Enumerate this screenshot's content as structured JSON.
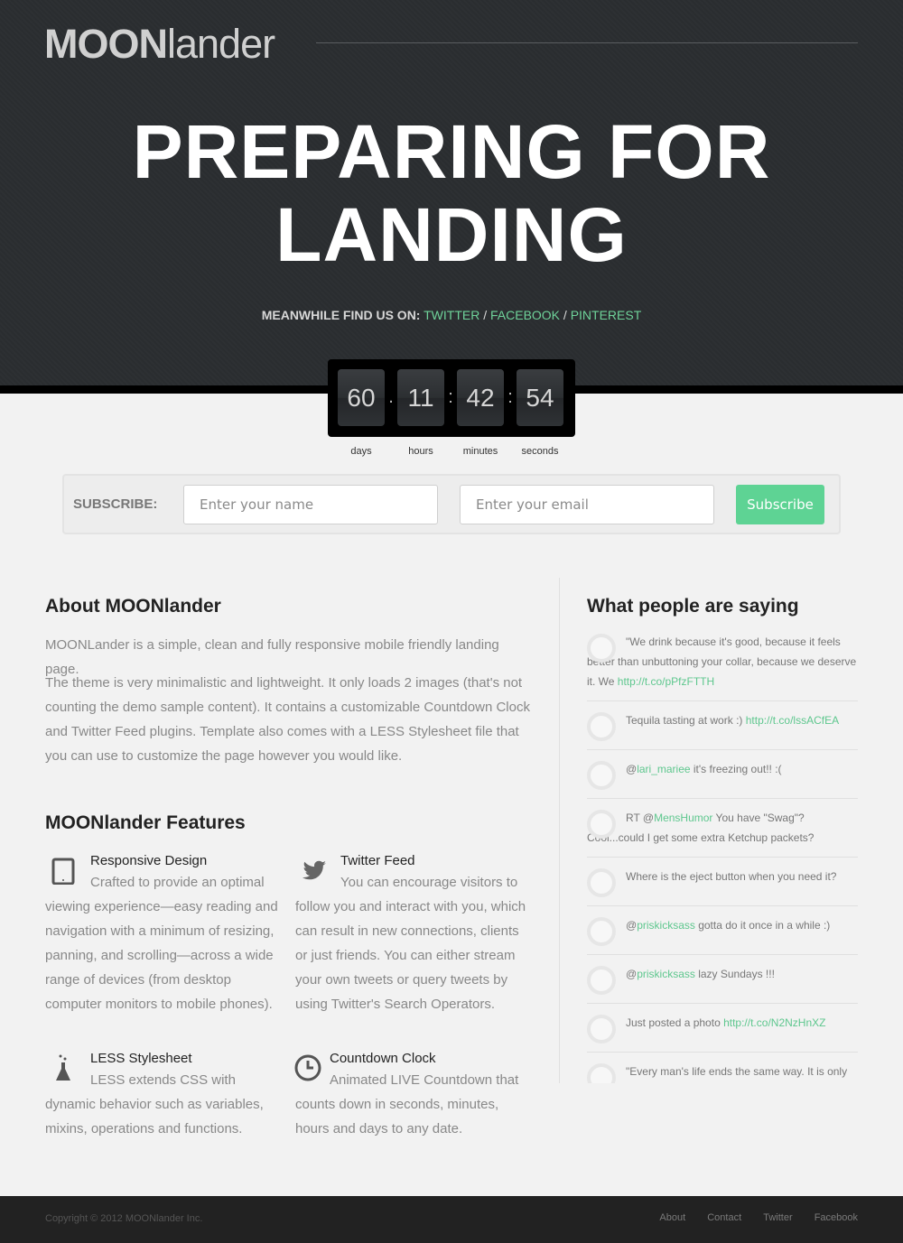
{
  "header": {
    "logo_bold": "MOON",
    "logo_light": "lander",
    "headline_line1": "PREPARING FOR",
    "headline_line2": "LANDING",
    "find_label": "MEANWHILE FIND US ON:",
    "links": [
      "TWITTER",
      "FACEBOOK",
      "PINTEREST"
    ],
    "separator": "/"
  },
  "countdown": {
    "values": [
      "60",
      "11",
      "42",
      "54"
    ],
    "units": [
      "days",
      "hours",
      "minutes",
      "seconds"
    ],
    "separator": ":",
    "first_separator": "."
  },
  "subscribe": {
    "label": "SUBSCRIBE:",
    "name_placeholder": "Enter your name",
    "email_placeholder": "Enter your email",
    "button": "Subscribe"
  },
  "about": {
    "title": "About MOONlander",
    "p1": "MOONLander is a simple, clean and fully responsive mobile friendly landing page.",
    "p2": "The theme is very minimalistic and lightweight. It only loads 2 images (that's not counting the demo sample content). It contains a customizable Countdown Clock and Twitter Feed plugins. Template also comes with a LESS Stylesheet file that you can use to customize the page however you would like."
  },
  "features": {
    "title": "MOONlander Features",
    "items": [
      {
        "icon": "tablet-icon",
        "title": "Responsive Design",
        "text": "Crafted to provide an optimal viewing experience—easy reading and navigation with a minimum of resizing, panning, and scrolling—across a wide range of devices (from desktop computer monitors to mobile phones)."
      },
      {
        "icon": "twitter-bird-icon",
        "title": "Twitter Feed",
        "text": "You can encourage visitors to follow you and interact with you, which can result in new connections, clients or just friends. You can either stream your own tweets or query tweets by using Twitter's Search Operators."
      },
      {
        "icon": "flask-icon",
        "title": "LESS Stylesheet",
        "text": "LESS extends CSS with dynamic behavior such as variables, mixins, operations and functions."
      },
      {
        "icon": "clock-icon",
        "title": "Countdown Clock",
        "text": "Animated LIVE Countdown that counts down in seconds, minutes, hours and days to any date."
      }
    ]
  },
  "testimonials": {
    "title": "What people are saying",
    "tweets": [
      {
        "before": "\"We drink because it's good, because it feels better than unbuttoning your collar, because we deserve it. We ",
        "link": "http://t.co/pPfzFTTH",
        "after": ""
      },
      {
        "before": "Tequila tasting at work :) ",
        "link": "http://t.co/lssACfEA",
        "after": ""
      },
      {
        "before": "@",
        "link": "lari_mariee",
        "after": " it's freezing out!! :("
      },
      {
        "before": "RT @",
        "link": "MensHumor",
        "after": " You have \"Swag\"? Cool...could I get some extra Ketchup packets?"
      },
      {
        "before": "Where is the eject button when you need it?",
        "link": "",
        "after": ""
      },
      {
        "before": "@",
        "link": "priskicksass",
        "after": " gotta do it once in a while :)"
      },
      {
        "before": "@",
        "link": "priskicksass",
        "after": " lazy Sundays !!!"
      },
      {
        "before": "Just posted a photo ",
        "link": "http://t.co/N2NzHnXZ",
        "after": ""
      },
      {
        "before": "\"Every man's life ends the same way. It is only",
        "link": "",
        "after": ""
      }
    ]
  },
  "footer": {
    "copyright": "Copyright © 2012 MOONlander Inc.",
    "links": [
      "About",
      "Contact",
      "Twitter",
      "Facebook"
    ]
  },
  "colors": {
    "accent": "#5ed394",
    "hero_bg": "#2b2e31",
    "footer_bg": "#222222"
  }
}
